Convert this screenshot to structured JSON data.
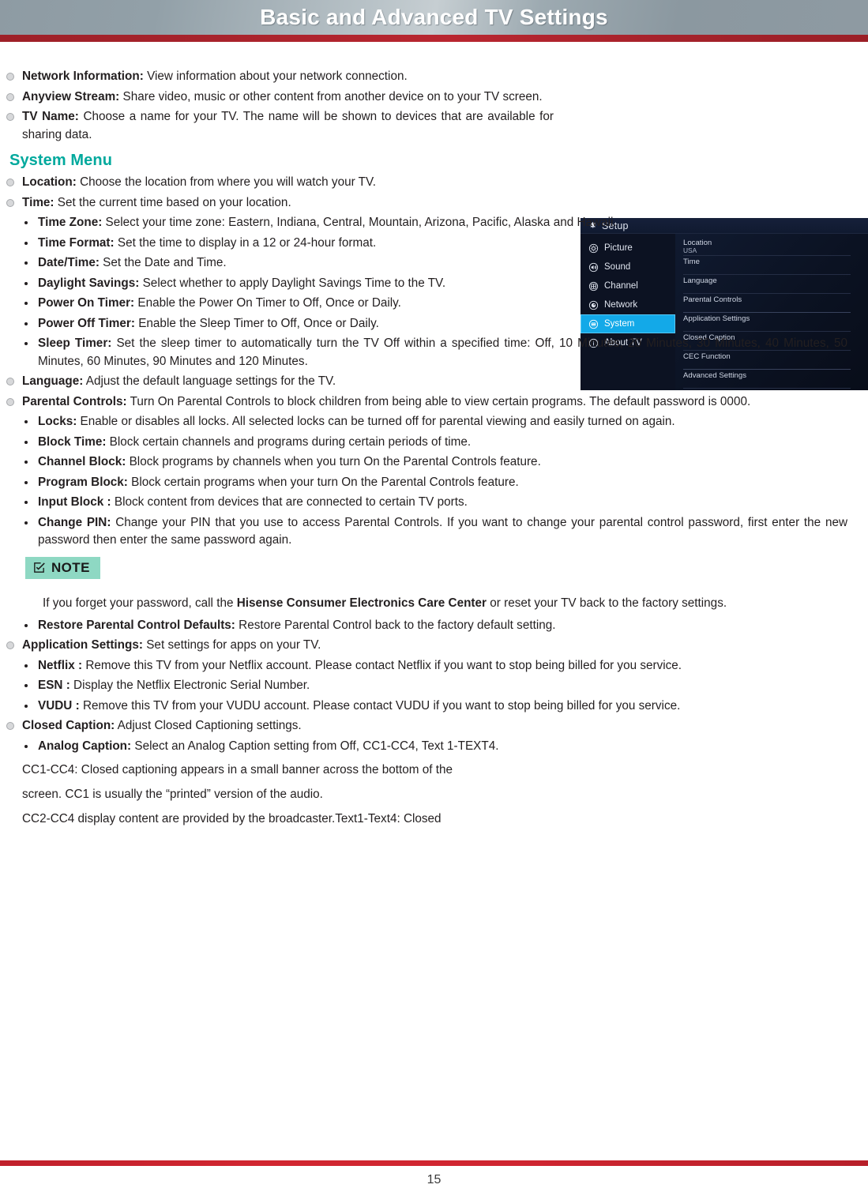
{
  "header": {
    "title": "Basic and Advanced TV Settings",
    "band_color": "#8b98a0",
    "rule_color": "#a8232c"
  },
  "intro_items": [
    {
      "term": "Network Information:",
      "desc": " View information about your network connection."
    },
    {
      "term": "Anyview Stream:",
      "desc": " Share video, music or other content from another device on to your TV screen."
    },
    {
      "term": "TV Name:",
      "desc": " Choose a name for your TV. The name will be shown to devices that are available for sharing data."
    }
  ],
  "section": {
    "title": "System Menu",
    "title_color": "#00a99d"
  },
  "system_items": [
    {
      "term": "Location:",
      "desc": " Choose the location from where you will watch your TV."
    },
    {
      "term": "Time:",
      "desc": " Set the current time based on your location."
    }
  ],
  "time_subitems": [
    {
      "term": "Time Zone:",
      "desc": " Select your time zone: Eastern, Indiana, Central, Mountain, Arizona, Pacific, Alaska and Hawaii."
    },
    {
      "term": "Time Format:",
      "desc": " Set the time to display in a 12 or 24-hour format."
    },
    {
      "term": "Date/Time:",
      "desc": " Set the Date and Time."
    },
    {
      "term": "Daylight Savings:",
      "desc": " Select whether to apply Daylight Savings Time to the TV."
    },
    {
      "term": "Power On Timer:",
      "desc": " Enable the Power On Timer to Off, Once or Daily."
    },
    {
      "term": "Power Off Timer:",
      "desc": " Enable the Sleep Timer to Off, Once or Daily."
    },
    {
      "term": "Sleep Timer:",
      "desc": "  Set the sleep timer to automatically turn the TV Off within a specified time: Off, 10 Minutes, 20 Minutes, 30 Minutes, 40 Minutes, 50 Minutes, 60 Minutes, 90 Minutes and 120 Minutes."
    }
  ],
  "language_item": {
    "term": "Language:",
    "desc": " Adjust the default language settings for the TV."
  },
  "parental_item": {
    "term": "Parental Controls:",
    "desc": " Turn On Parental Controls to block children from being able to view certain programs. The default password is 0000."
  },
  "parental_subitems": [
    {
      "term": "Locks:",
      "desc": " Enable or disables all locks. All selected locks can be turned off for parental viewing and easily turned on again."
    },
    {
      "term": "Block Time:",
      "desc": " Block certain channels and programs during certain periods of time."
    },
    {
      "term": "Channel Block:",
      "desc": " Block programs by channels when you turn On the Parental Controls feature."
    },
    {
      "term": "Program Block:",
      "desc": " Block certain programs when your turn On the Parental Controls feature."
    },
    {
      "term": "Input Block :",
      "desc": " Block content from devices that are connected to certain TV ports."
    },
    {
      "term": "Change PIN:",
      "desc": " Change your PIN that you use to access Parental Controls. If you want to change your parental control password, first enter the new password then enter the same password again."
    }
  ],
  "note": {
    "label": "NOTE",
    "badge_color": "#8ed8c3",
    "icon": "checkbox-pen-icon",
    "text_before": "If you forget your password, call the ",
    "text_bold": "Hisense Consumer Electronics Care Center",
    "text_after": " or reset your TV back to the factory settings."
  },
  "restore_item": {
    "term": "Restore Parental Control Defaults:",
    "desc": " Restore Parental Control back to the factory default setting."
  },
  "application_item": {
    "term": "Application Settings:",
    "desc": " Set settings for apps on your TV."
  },
  "application_subitems": [
    {
      "term": "Netflix :",
      "desc": " Remove this TV from your Netflix account. Please contact Netflix if you want to stop being billed for you service."
    },
    {
      "term": "ESN :",
      "desc": " Display the Netflix Electronic Serial Number."
    },
    {
      "term": "VUDU :",
      "desc": " Remove this TV from your VUDU account. Please contact VUDU if you want to stop being billed for you service."
    }
  ],
  "closed_caption_item": {
    "term": "Closed Caption:",
    "desc": " Adjust Closed Captioning settings."
  },
  "closed_caption_subitems": [
    {
      "term": "Analog Caption:",
      "desc": " Select an Analog Caption setting from Off, CC1-CC4, Text 1-TEXT4."
    }
  ],
  "closing_paragraphs": [
    "CC1-CC4: Closed captioning appears in a small banner across the bottom of the",
    "screen. CC1 is usually the “printed” version of the audio.",
    "CC2-CC4 display content are provided by the broadcaster.Text1-Text4: Closed"
  ],
  "tv_menu": {
    "title": "Setup",
    "title_icon": "gear-icon",
    "highlight_color": "#13a9e8",
    "sidebar": [
      {
        "label": "Picture",
        "icon": "picture-icon",
        "active": false
      },
      {
        "label": "Sound",
        "icon": "sound-icon",
        "active": false
      },
      {
        "label": "Channel",
        "icon": "channel-icon",
        "active": false
      },
      {
        "label": "Network",
        "icon": "network-icon",
        "active": false
      },
      {
        "label": "System",
        "icon": "system-icon",
        "active": true
      },
      {
        "label": "About TV",
        "icon": "info-icon",
        "active": false
      }
    ],
    "rows": [
      {
        "label": "Location",
        "value": "USA"
      },
      {
        "label": "Time",
        "value": ""
      },
      {
        "label": "Language",
        "value": ""
      },
      {
        "label": "Parental Controls",
        "value": ""
      },
      {
        "label": "Application Settings",
        "value": ""
      },
      {
        "label": "Closed Caption",
        "value": ""
      },
      {
        "label": "CEC Function",
        "value": ""
      },
      {
        "label": "Advanced Settings",
        "value": ""
      }
    ]
  },
  "footer": {
    "page_number": "15",
    "rule_color": "#cf2530"
  }
}
